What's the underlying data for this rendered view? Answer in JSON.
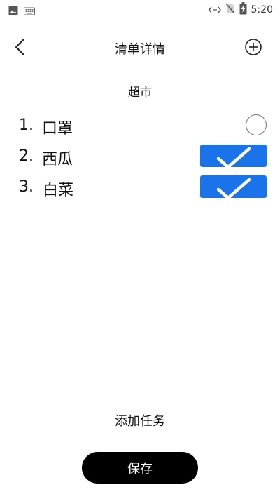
{
  "status_bar": {
    "time": "5:20",
    "icons": [
      "image-icon",
      "keyboard-icon",
      "data-arrows-icon",
      "no-sim-icon",
      "battery-charging-icon"
    ]
  },
  "header": {
    "title": "清单详情",
    "back_icon": "chevron-left-icon",
    "add_icon": "plus-circle-icon"
  },
  "list_name": "超市",
  "items": [
    {
      "index": "1.",
      "text": "口罩",
      "done": false
    },
    {
      "index": "2.",
      "text": "西瓜",
      "done": true
    },
    {
      "index": "3.",
      "text": "白菜",
      "done": true
    }
  ],
  "add_task_label": "添加任务",
  "save_label": "保存",
  "colors": {
    "check_done": "#1a73e8",
    "save_button": "#000000",
    "background": "#ffffff"
  }
}
